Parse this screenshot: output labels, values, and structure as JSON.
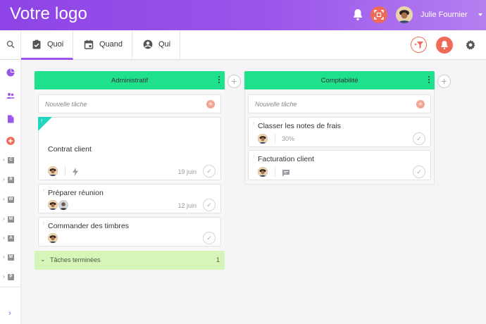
{
  "header": {
    "logo": "Votre logo",
    "user_name": "Julie Fournier"
  },
  "tabs": [
    {
      "label": "Quoi",
      "active": true
    },
    {
      "label": "Quand",
      "active": false
    },
    {
      "label": "Qui",
      "active": false
    }
  ],
  "sidebar": {
    "projects": [
      "C",
      "R",
      "W",
      "M",
      "A",
      "M",
      "P"
    ]
  },
  "columns": [
    {
      "title": "Administratif",
      "new_task_placeholder": "Nouvelle tâche",
      "cards": [
        {
          "title": "Contrat client",
          "date": "19 juin"
        },
        {
          "title": "Préparer réunion",
          "date": "12 juin"
        },
        {
          "title": "Commander des timbres",
          "date": ""
        }
      ],
      "done": {
        "label": "Tâches terminées",
        "count": "1"
      }
    },
    {
      "title": "Comptabilité",
      "new_task_placeholder": "Nouvelle tâche",
      "cards": [
        {
          "title": "Classer les notes de frais",
          "progress": "30%"
        },
        {
          "title": "Facturation client"
        }
      ]
    }
  ],
  "colors": {
    "accent": "#9a55ea",
    "column_header": "#1fe08d",
    "danger": "#ef6b58",
    "done_bg": "#d6f5b8"
  }
}
